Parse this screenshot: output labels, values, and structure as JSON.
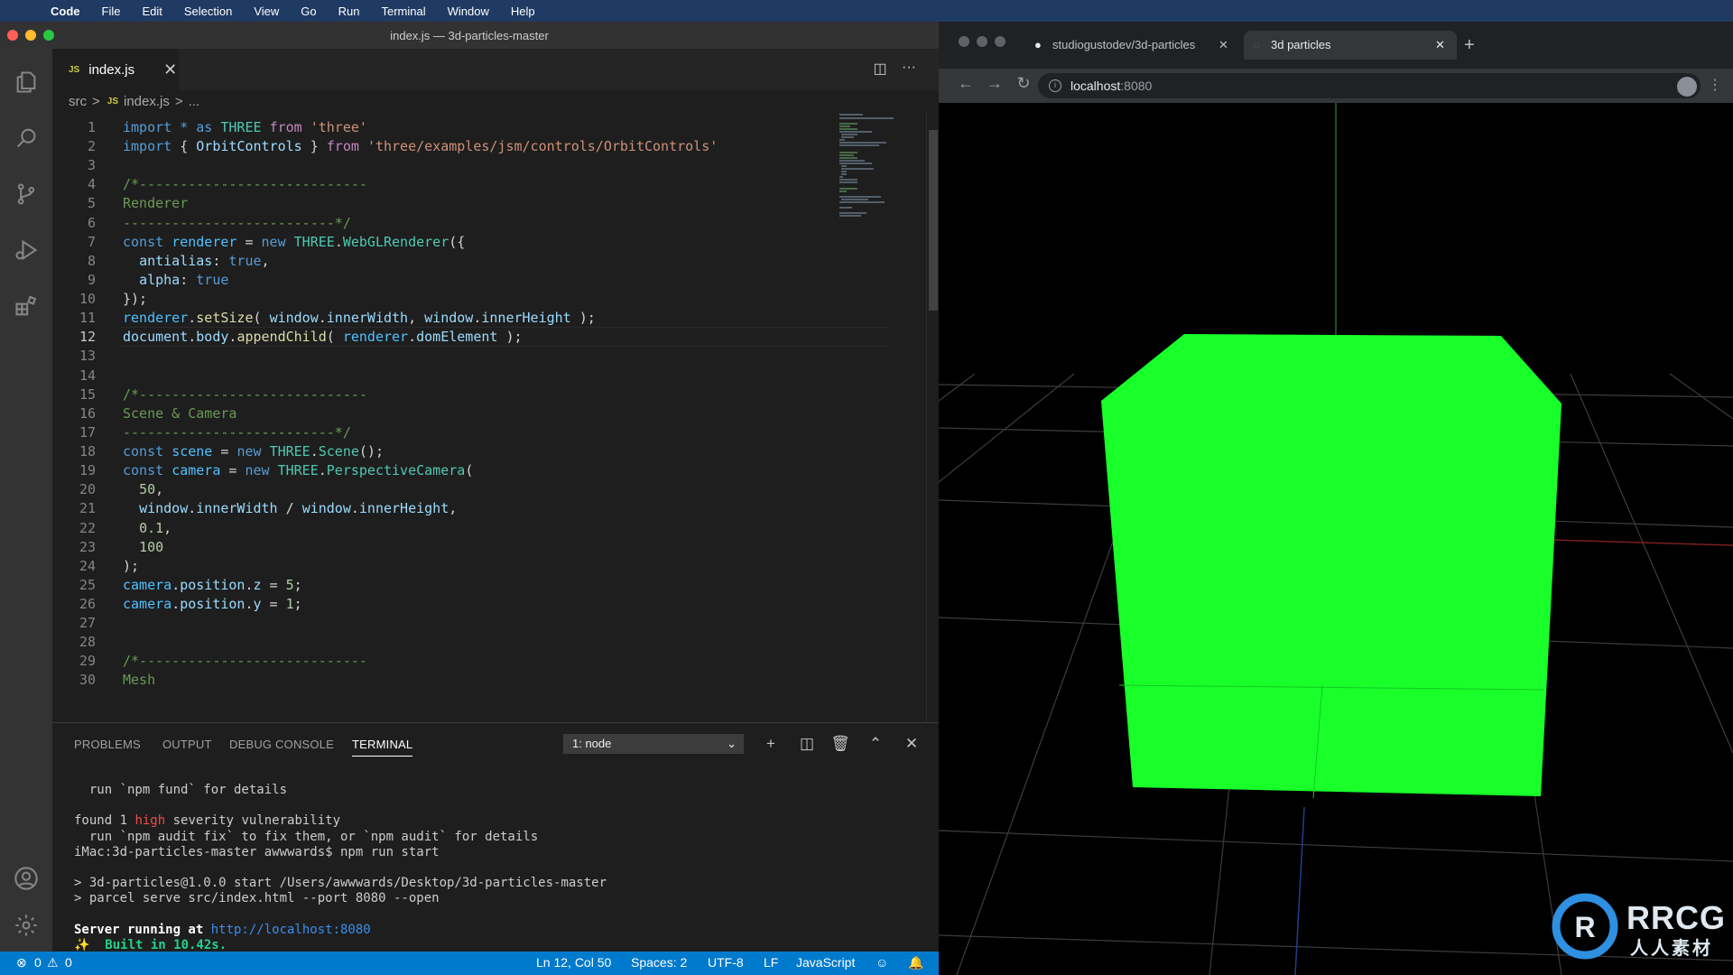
{
  "menubar": {
    "app": "Code",
    "items": [
      "File",
      "Edit",
      "Selection",
      "View",
      "Go",
      "Run",
      "Terminal",
      "Window",
      "Help"
    ]
  },
  "vscode": {
    "window_title": "index.js — 3d-particles-master",
    "tab": {
      "icon_label": "JS",
      "label": "index.js",
      "close": "✕"
    },
    "breadcrumb": {
      "folder": "src",
      "sep": ">",
      "icon_label": "JS",
      "file": "index.js",
      "more": "..."
    },
    "activity_icons": [
      "explorer-icon",
      "search-icon",
      "source-control-icon",
      "run-debug-icon",
      "extensions-icon",
      "account-icon",
      "settings-gear-icon"
    ],
    "current_line": 12,
    "code_lines": [
      {
        "n": "1",
        "tokens": [
          [
            "k",
            "import"
          ],
          [
            "p",
            " "
          ],
          [
            "k",
            "*"
          ],
          [
            "p",
            " "
          ],
          [
            "k",
            "as"
          ],
          [
            "p",
            " "
          ],
          [
            "t",
            "THREE"
          ],
          [
            "p",
            " "
          ],
          [
            "kw",
            "from"
          ],
          [
            "p",
            " "
          ],
          [
            "s",
            "'three'"
          ]
        ]
      },
      {
        "n": "2",
        "tokens": [
          [
            "k",
            "import"
          ],
          [
            "p",
            " { "
          ],
          [
            "v",
            "OrbitControls"
          ],
          [
            "p",
            " } "
          ],
          [
            "kw",
            "from"
          ],
          [
            "p",
            " "
          ],
          [
            "s",
            "'three/examples/jsm/controls/OrbitControls'"
          ]
        ]
      },
      {
        "n": "3",
        "tokens": []
      },
      {
        "n": "4",
        "tokens": [
          [
            "c",
            "/*----------------------------"
          ]
        ]
      },
      {
        "n": "5",
        "tokens": [
          [
            "c",
            "Renderer"
          ]
        ]
      },
      {
        "n": "6",
        "tokens": [
          [
            "c",
            "--------------------------*/"
          ]
        ]
      },
      {
        "n": "7",
        "tokens": [
          [
            "k",
            "const"
          ],
          [
            "p",
            " "
          ],
          [
            "cst",
            "renderer"
          ],
          [
            "p",
            " = "
          ],
          [
            "k",
            "new"
          ],
          [
            "p",
            " "
          ],
          [
            "t",
            "THREE"
          ],
          [
            "p",
            "."
          ],
          [
            "t",
            "WebGLRenderer"
          ],
          [
            "p",
            "({"
          ]
        ]
      },
      {
        "n": "8",
        "tokens": [
          [
            "p",
            "  "
          ],
          [
            "v",
            "antialias"
          ],
          [
            "p",
            ": "
          ],
          [
            "k",
            "true"
          ],
          [
            "p",
            ","
          ]
        ]
      },
      {
        "n": "9",
        "tokens": [
          [
            "p",
            "  "
          ],
          [
            "v",
            "alpha"
          ],
          [
            "p",
            ": "
          ],
          [
            "k",
            "true"
          ]
        ]
      },
      {
        "n": "10",
        "tokens": [
          [
            "p",
            "});"
          ]
        ]
      },
      {
        "n": "11",
        "tokens": [
          [
            "cst",
            "renderer"
          ],
          [
            "p",
            "."
          ],
          [
            "f",
            "setSize"
          ],
          [
            "p",
            "( "
          ],
          [
            "v",
            "window"
          ],
          [
            "p",
            "."
          ],
          [
            "v",
            "innerWidth"
          ],
          [
            "p",
            ", "
          ],
          [
            "v",
            "window"
          ],
          [
            "p",
            "."
          ],
          [
            "v",
            "innerHeight"
          ],
          [
            "p",
            " );"
          ]
        ]
      },
      {
        "n": "12",
        "tokens": [
          [
            "v",
            "document"
          ],
          [
            "p",
            "."
          ],
          [
            "v",
            "body"
          ],
          [
            "p",
            "."
          ],
          [
            "f",
            "appendChild"
          ],
          [
            "p",
            "( "
          ],
          [
            "cst",
            "renderer"
          ],
          [
            "p",
            "."
          ],
          [
            "v",
            "domElement"
          ],
          [
            "p",
            " );"
          ]
        ]
      },
      {
        "n": "13",
        "tokens": []
      },
      {
        "n": "14",
        "tokens": []
      },
      {
        "n": "15",
        "tokens": [
          [
            "c",
            "/*----------------------------"
          ]
        ]
      },
      {
        "n": "16",
        "tokens": [
          [
            "c",
            "Scene & Camera"
          ]
        ]
      },
      {
        "n": "17",
        "tokens": [
          [
            "c",
            "--------------------------*/"
          ]
        ]
      },
      {
        "n": "18",
        "tokens": [
          [
            "k",
            "const"
          ],
          [
            "p",
            " "
          ],
          [
            "cst",
            "scene"
          ],
          [
            "p",
            " = "
          ],
          [
            "k",
            "new"
          ],
          [
            "p",
            " "
          ],
          [
            "t",
            "THREE"
          ],
          [
            "p",
            "."
          ],
          [
            "t",
            "Scene"
          ],
          [
            "p",
            "();"
          ]
        ]
      },
      {
        "n": "19",
        "tokens": [
          [
            "k",
            "const"
          ],
          [
            "p",
            " "
          ],
          [
            "cst",
            "camera"
          ],
          [
            "p",
            " = "
          ],
          [
            "k",
            "new"
          ],
          [
            "p",
            " "
          ],
          [
            "t",
            "THREE"
          ],
          [
            "p",
            "."
          ],
          [
            "t",
            "PerspectiveCamera"
          ],
          [
            "p",
            "("
          ]
        ]
      },
      {
        "n": "20",
        "tokens": [
          [
            "p",
            "  "
          ],
          [
            "n",
            "50"
          ],
          [
            "p",
            ","
          ]
        ]
      },
      {
        "n": "21",
        "tokens": [
          [
            "p",
            "  "
          ],
          [
            "v",
            "window"
          ],
          [
            "p",
            "."
          ],
          [
            "v",
            "innerWidth"
          ],
          [
            "p",
            " / "
          ],
          [
            "v",
            "window"
          ],
          [
            "p",
            "."
          ],
          [
            "v",
            "innerHeight"
          ],
          [
            "p",
            ","
          ]
        ]
      },
      {
        "n": "22",
        "tokens": [
          [
            "p",
            "  "
          ],
          [
            "n",
            "0.1"
          ],
          [
            "p",
            ","
          ]
        ]
      },
      {
        "n": "23",
        "tokens": [
          [
            "p",
            "  "
          ],
          [
            "n",
            "100"
          ]
        ]
      },
      {
        "n": "24",
        "tokens": [
          [
            "p",
            ");"
          ]
        ]
      },
      {
        "n": "25",
        "tokens": [
          [
            "cst",
            "camera"
          ],
          [
            "p",
            "."
          ],
          [
            "v",
            "position"
          ],
          [
            "p",
            "."
          ],
          [
            "v",
            "z"
          ],
          [
            "p",
            " = "
          ],
          [
            "n",
            "5"
          ],
          [
            "p",
            ";"
          ]
        ]
      },
      {
        "n": "26",
        "tokens": [
          [
            "cst",
            "camera"
          ],
          [
            "p",
            "."
          ],
          [
            "v",
            "position"
          ],
          [
            "p",
            "."
          ],
          [
            "v",
            "y"
          ],
          [
            "p",
            " = "
          ],
          [
            "n",
            "1"
          ],
          [
            "p",
            ";"
          ]
        ]
      },
      {
        "n": "27",
        "tokens": []
      },
      {
        "n": "28",
        "tokens": []
      },
      {
        "n": "29",
        "tokens": [
          [
            "c",
            "/*----------------------------"
          ]
        ]
      },
      {
        "n": "30",
        "tokens": [
          [
            "c",
            "Mesh"
          ]
        ]
      }
    ],
    "panel": {
      "tabs": [
        "PROBLEMS",
        "OUTPUT",
        "DEBUG CONSOLE",
        "TERMINAL"
      ],
      "active_tab": "TERMINAL",
      "terminal_select": "1: node",
      "terminal_lines": [
        [
          [
            "p",
            "  run `npm fund` for details"
          ]
        ],
        [
          [
            "p",
            ""
          ]
        ],
        [
          [
            "p",
            "found 1 "
          ],
          [
            "red",
            "high"
          ],
          [
            "p",
            " severity vulnerability"
          ]
        ],
        [
          [
            "p",
            "  run `npm audit fix` to fix them, or `npm audit` for details"
          ]
        ],
        [
          [
            "p",
            "iMac:3d-particles-master awwwards$ npm run start"
          ]
        ],
        [
          [
            "p",
            ""
          ]
        ],
        [
          [
            "p",
            "> 3d-particles@1.0.0 start /Users/awwwards/Desktop/3d-particles-master"
          ]
        ],
        [
          [
            "p",
            "> parcel serve src/index.html --port 8080 --open"
          ]
        ],
        [
          [
            "p",
            ""
          ]
        ],
        [
          [
            "bold",
            "Server running at "
          ],
          [
            "link",
            "http://localhost:8080"
          ]
        ],
        [
          [
            "green",
            "✨  Built in 10.42s."
          ]
        ],
        [
          [
            "p",
            "▯"
          ]
        ]
      ]
    },
    "status": {
      "errors": "0",
      "warnings": "0",
      "position": "Ln 12, Col 50",
      "spaces": "Spaces: 2",
      "encoding": "UTF-8",
      "eol": "LF",
      "language": "JavaScript"
    }
  },
  "browser": {
    "tabs": [
      {
        "label": "studiogustodev/3d-particles",
        "close": "✕"
      },
      {
        "label": "3d particles",
        "close": "✕"
      }
    ],
    "new_tab": "+",
    "url_host": "localhost",
    "url_port": ":8080",
    "scene_color": "#18ff2a"
  },
  "watermark": {
    "text": "RRCG",
    "sub": "人人素材"
  }
}
